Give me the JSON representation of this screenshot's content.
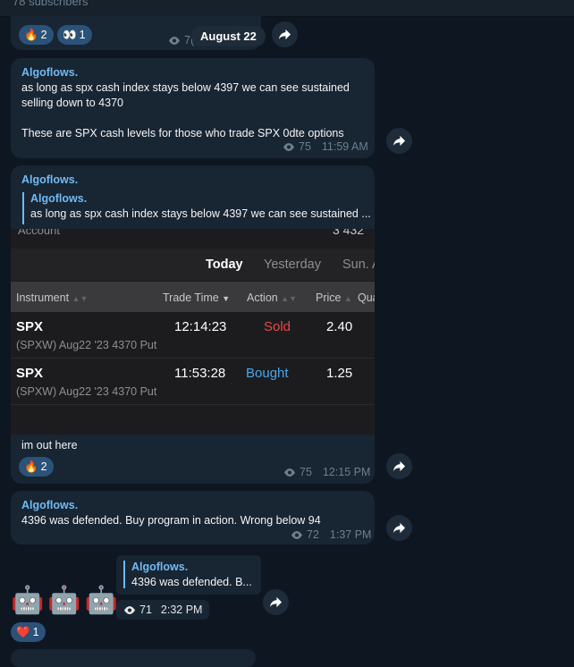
{
  "channel": {
    "subscribers_text": "78 subscribers"
  },
  "date_separator": "August 22",
  "msg0": {
    "reactions": [
      {
        "emoji": "🔥",
        "count": "2"
      },
      {
        "emoji": "👀",
        "count": "1"
      }
    ],
    "views_partial": "7("
  },
  "msg1": {
    "sender": "Algoflows.",
    "line1": "as long as spx cash index stays below 4397 we can see sustained",
    "line2": "selling down to 4370",
    "line3": "These are SPX cash levels for those who trade SPX 0dte options",
    "views": "75",
    "time": "11:59 AM"
  },
  "msg2": {
    "sender": "Algoflows.",
    "quote_sender": "Algoflows.",
    "quote_text": "as long as spx cash index stays below 4397 we can see sustained ...",
    "text": "im out here",
    "reactions": [
      {
        "emoji": "🔥",
        "count": "2"
      }
    ],
    "views": "75",
    "time": "12:15 PM",
    "screenshot": {
      "header_partial_left": "Account",
      "header_partial_right": "3 432",
      "tabs": [
        "Today",
        "Yesterday",
        "Sun. A"
      ],
      "columns": [
        "Instrument",
        "Trade Time",
        "Action",
        "Price",
        "Qua"
      ],
      "rows": [
        {
          "symbol": "SPX",
          "desc": "(SPXW) Aug22 '23 4370 Put",
          "time": "12:14:23",
          "action": "Sold",
          "price": "2.40"
        },
        {
          "symbol": "SPX",
          "desc": "(SPXW) Aug22 '23 4370 Put",
          "time": "11:53:28",
          "action": "Bought",
          "price": "1.25"
        }
      ],
      "colors": {
        "sold": "#e5484d",
        "bought": "#4aa6e8"
      }
    }
  },
  "msg3": {
    "sender": "Algoflows.",
    "text": "4396 was defended. Buy program in action. Wrong below 94",
    "views": "72",
    "time": "1:37 PM"
  },
  "msg4": {
    "emojis": [
      "🤖",
      "🤖",
      "🤖"
    ],
    "reactions": [
      {
        "emoji": "❤️",
        "count": "1"
      }
    ],
    "reply_sender": "Algoflows.",
    "reply_text": "4396 was defended. B...",
    "views": "71",
    "time": "2:32 PM"
  },
  "colors": {
    "background": "#0e1621",
    "bubble": "#182533",
    "accent": "#71baf2",
    "reaction": "#2b5278"
  },
  "icons": [
    "eye-icon",
    "share-icon",
    "sort-icon"
  ]
}
